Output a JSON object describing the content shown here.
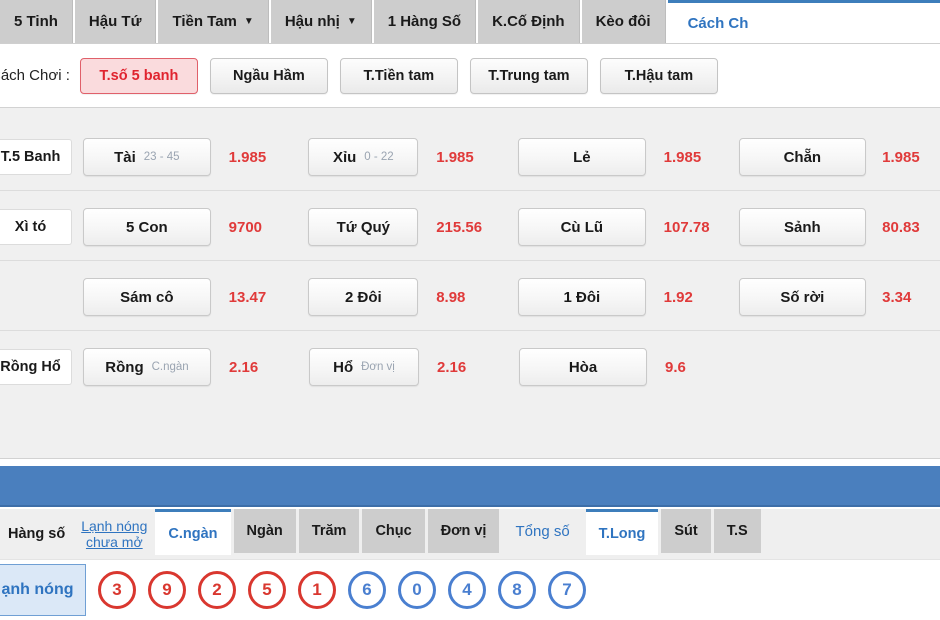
{
  "top_tabs": [
    {
      "label": "5 Tinh",
      "caret": false,
      "active": false
    },
    {
      "label": "Hậu Tứ",
      "caret": false,
      "active": false
    },
    {
      "label": "Tiền Tam",
      "caret": true,
      "active": false
    },
    {
      "label": "Hậu nhị",
      "caret": true,
      "active": false
    },
    {
      "label": "1 Hàng Số",
      "caret": false,
      "active": false
    },
    {
      "label": "K.Cố Định",
      "caret": false,
      "active": false
    },
    {
      "label": "Kèo đôi",
      "caret": false,
      "active": false
    },
    {
      "label": "Cách Ch",
      "caret": false,
      "active": true
    }
  ],
  "play_row": {
    "label": "Cách Chơi :",
    "buttons": [
      {
        "label": "T.số 5 banh",
        "selected": true
      },
      {
        "label": "Ngầu Hầm",
        "selected": false
      },
      {
        "label": "T.Tiền tam",
        "selected": false
      },
      {
        "label": "T.Trung tam",
        "selected": false
      },
      {
        "label": "T.Hậu tam",
        "selected": false
      }
    ]
  },
  "odds_rows": [
    {
      "row_label": "T.5 Banh",
      "cells": [
        {
          "name": "Tài",
          "sub": "23 - 45",
          "odds": "1.985"
        },
        {
          "name": "Xỉu",
          "sub": "0 - 22",
          "odds": "1.985"
        },
        {
          "name": "Lẻ",
          "sub": "",
          "odds": "1.985"
        },
        {
          "name": "Chẵn",
          "sub": "",
          "odds": "1.985"
        }
      ]
    },
    {
      "row_label": "Xì tó",
      "cells": [
        {
          "name": "5 Con",
          "sub": "",
          "odds": "9700"
        },
        {
          "name": "Tứ Quý",
          "sub": "",
          "odds": "215.56"
        },
        {
          "name": "Cù Lũ",
          "sub": "",
          "odds": "107.78"
        },
        {
          "name": "Sảnh",
          "sub": "",
          "odds": "80.83"
        }
      ]
    },
    {
      "row_label": "",
      "cells": [
        {
          "name": "Sám cô",
          "sub": "",
          "odds": "13.47"
        },
        {
          "name": "2 Đôi",
          "sub": "",
          "odds": "8.98"
        },
        {
          "name": "1 Đôi",
          "sub": "",
          "odds": "1.92"
        },
        {
          "name": "Số rời",
          "sub": "",
          "odds": "3.34"
        }
      ]
    },
    {
      "row_label": "Rồng Hổ",
      "cells": [
        {
          "name": "Rồng",
          "sub": "C.ngàn",
          "odds": "2.16"
        },
        {
          "name": "Hổ",
          "sub": "Đơn vị",
          "odds": "2.16"
        },
        {
          "name": "Hòa",
          "sub": "",
          "odds": "9.6"
        }
      ]
    }
  ],
  "bottom_bar": {
    "hang_so_label": "Hàng số",
    "lanh_nong_link_line1": "Lạnh nóng",
    "lanh_nong_link_line2": "chưa mở",
    "digit_tabs": [
      {
        "label": "C.ngàn",
        "active": true
      },
      {
        "label": "Ngàn",
        "active": false
      },
      {
        "label": "Trăm",
        "active": false
      },
      {
        "label": "Chục",
        "active": false
      },
      {
        "label": "Đơn vị",
        "active": false
      }
    ],
    "tong_so_label": "Tổng số",
    "result_tabs": [
      {
        "label": "T.Long",
        "active": true
      },
      {
        "label": "Sút",
        "active": false
      },
      {
        "label": "T.S",
        "active": false
      }
    ]
  },
  "number_row": {
    "hotcold_label": "ạnh nóng",
    "balls": [
      {
        "value": "3",
        "type": "hot"
      },
      {
        "value": "9",
        "type": "hot"
      },
      {
        "value": "2",
        "type": "hot"
      },
      {
        "value": "5",
        "type": "hot"
      },
      {
        "value": "1",
        "type": "hot"
      },
      {
        "value": "6",
        "type": "cold"
      },
      {
        "value": "0",
        "type": "cold"
      },
      {
        "value": "4",
        "type": "cold"
      },
      {
        "value": "8",
        "type": "cold"
      },
      {
        "value": "7",
        "type": "cold"
      }
    ]
  },
  "colors": {
    "accent_blue": "#2f74c0",
    "bar_blue": "#4a7fbe",
    "odds_red": "#e03a3a",
    "selected_bg": "#fadbdd",
    "tab_gray": "#cdcdcd"
  }
}
